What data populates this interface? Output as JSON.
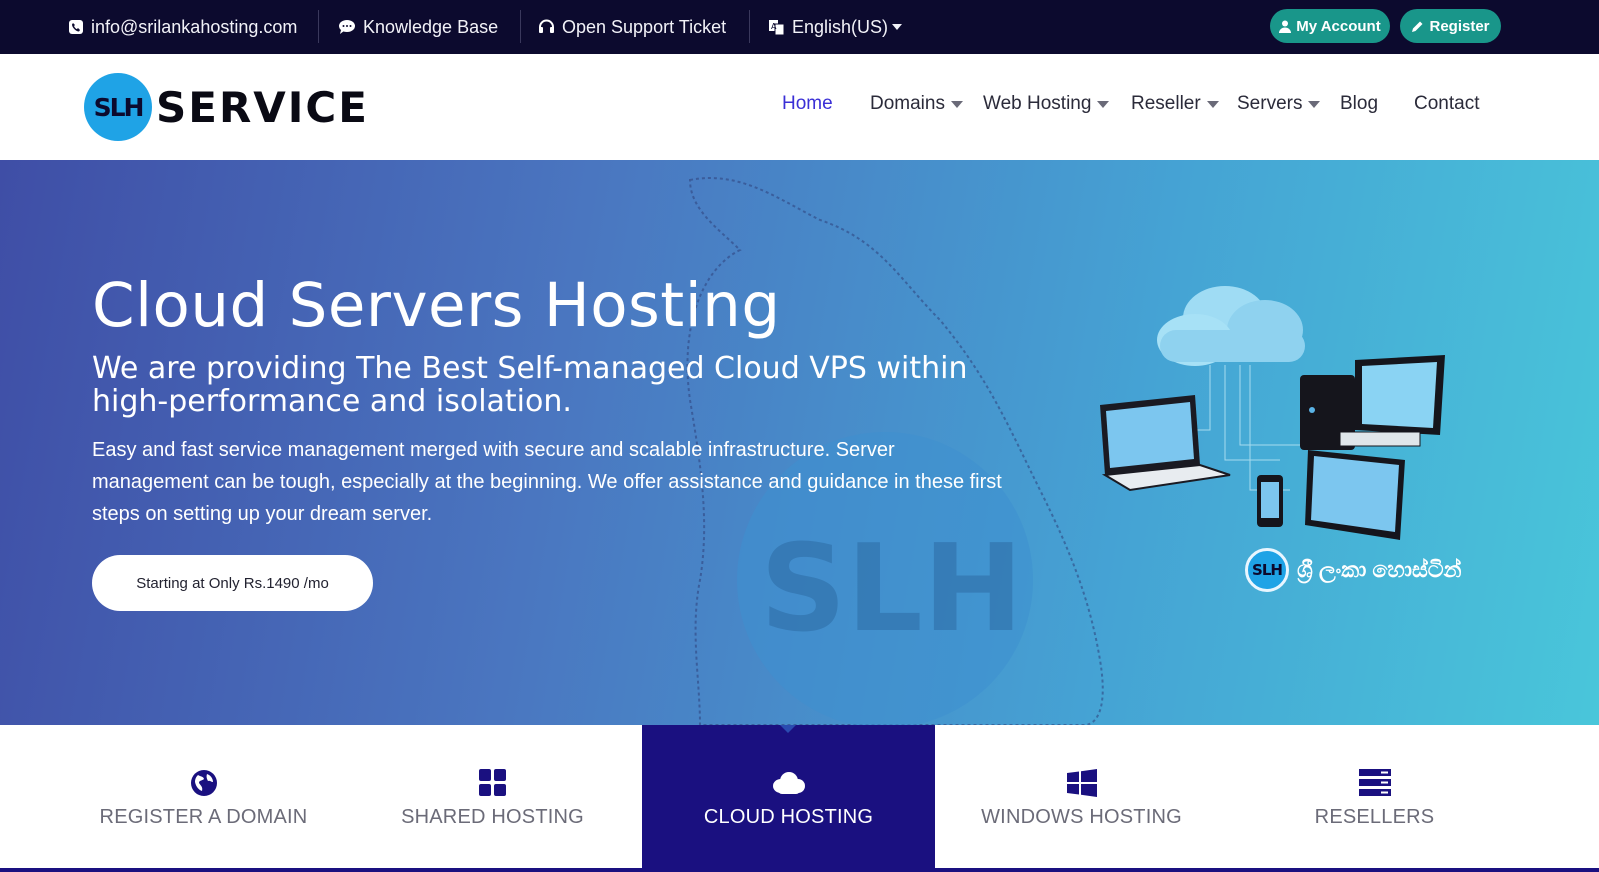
{
  "topbar": {
    "email": "info@srilankahosting.com",
    "knowledge_base": "Knowledge Base",
    "support_ticket": "Open Support Ticket",
    "language": "English(US)",
    "my_account": "My Account",
    "register": "Register",
    "bg_color": "#0c0a2e",
    "button_color": "#19968a"
  },
  "header": {
    "logo_mark": "SLH",
    "logo_text": "SERVICE",
    "nav": {
      "home": "Home",
      "domains": "Domains",
      "web_hosting": "Web Hosting",
      "reseller": "Reseller",
      "servers": "Servers",
      "blog": "Blog",
      "contact": "Contact"
    },
    "active_color": "#3a2fd6"
  },
  "hero": {
    "title": "Cloud Servers Hosting",
    "subtitle": "We are providing The Best Self-managed Cloud VPS within high-performance and isolation.",
    "description": "Easy and fast service management merged with secure and scalable infrastructure. Server management can be tough, especially at the beginning. We offer assistance and guidance in these first steps on setting up your dream server.",
    "cta": "Starting at Only Rs.1490 /mo",
    "badge_mark": "SLH",
    "badge_text": "ශ්‍රී ලංකා හොස්ටින්"
  },
  "features": {
    "tabs": [
      {
        "label": "REGISTER A DOMAIN",
        "icon": "globe-icon"
      },
      {
        "label": "SHARED HOSTING",
        "icon": "grid-icon"
      },
      {
        "label": "CLOUD HOSTING",
        "icon": "cloud-icon"
      },
      {
        "label": "WINDOWS HOSTING",
        "icon": "windows-icon"
      },
      {
        "label": "RESELLERS",
        "icon": "server-rack-icon"
      }
    ],
    "active_index": 2,
    "active_color": "#1a1080"
  }
}
